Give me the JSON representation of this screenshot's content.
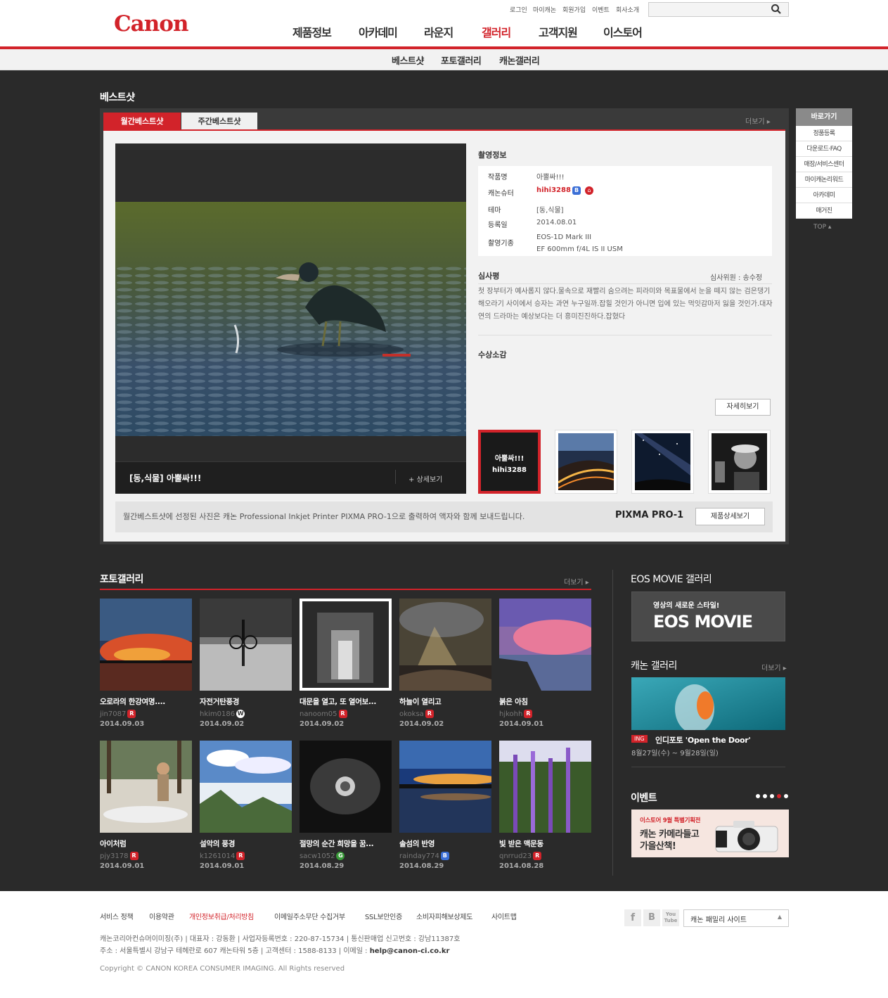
{
  "header": {
    "logo_text": "Canon",
    "util_links": [
      "로그인",
      "마이캐논",
      "회원가입",
      "이벤트",
      "회사소개"
    ],
    "search_placeholder": "",
    "gnb": [
      "제품정보",
      "아카데미",
      "라운지",
      "갤러리",
      "고객지원",
      "이스토어"
    ],
    "subnav": [
      "베스트샷",
      "포토갤러리",
      "캐논갤러리"
    ]
  },
  "best": {
    "section_title": "베스트샷",
    "tabs": [
      "월간베스트샷",
      "주간베스트샷"
    ],
    "more": "더보기",
    "caption": "[동,식물] 아뿔싸!!!",
    "detail_link": "상세보기",
    "info_title": "촬영정보",
    "info": {
      "work_label": "작품명",
      "work_value": "아뿔싸!!!",
      "shooter_label": "캐논슈터",
      "shooter_value": "hihi3288",
      "theme_label": "테마",
      "theme_value": "[동,식물]",
      "date_label": "등록일",
      "date_value": "2014.08.01",
      "camera_label": "촬영기종",
      "camera_value1": "EOS-1D Mark III",
      "camera_value2": "EF 600mm f/4L IS II USM"
    },
    "review_title": "심사평",
    "judge": "심사위원 : 송수정",
    "review_text": "첫 장부터가 예사롭지 않다.물속으로 재빨리 숨으려는 피라미와 목표물에서 눈을 떼지 않는 검은댕기해오라기 사이에서 승자는 과연 누구일까.잡힐 것인가 아니면 입에 있는 먹잇감마저 잃을 것인가.대자연의 드라마는 예상보다는 더 흥미진진하다.잡혔다",
    "award_title": "수상소감",
    "detail_button": "자세히보기",
    "active_thumb_title": "아뿔싸!!!",
    "active_thumb_user": "hihi3288",
    "notice": "월간베스트샷에 선정된 사진은 캐논 Professional Inkjet Printer PIXMA PRO-1으로 출력하여 액자와 함께 보내드립니다.",
    "product_name": "PIXMA PRO-1",
    "product_button": "제품상세보기"
  },
  "quick": {
    "title": "바로가기",
    "items": [
      "정품등록",
      "다운로드·FAQ",
      "매장/서비스센터",
      "마이캐논리워드",
      "아카데미",
      "매거진"
    ],
    "top": "TOP"
  },
  "gallery": {
    "title": "포토갤러리",
    "more": "더보기",
    "items": [
      {
        "title": "오로라의 한강여명....",
        "user": "jin7087",
        "badge": "R",
        "date": "2014.09.03"
      },
      {
        "title": "자전거탄풍경",
        "user": "hkim0186",
        "badge": "W",
        "date": "2014.09.02"
      },
      {
        "title": "대문을 열고, 또 열어보...",
        "user": "nanoom05",
        "badge": "R",
        "date": "2014.09.02"
      },
      {
        "title": "하늘이 열리고",
        "user": "okoksa",
        "badge": "R",
        "date": "2014.09.02"
      },
      {
        "title": "붉은 아침",
        "user": "hjkohh",
        "badge": "R",
        "date": "2014.09.01"
      },
      {
        "title": "아이처럼",
        "user": "pjy3178",
        "badge": "R",
        "date": "2014.09.01"
      },
      {
        "title": "설악의 풍경",
        "user": "k1261014",
        "badge": "R",
        "date": "2014.09.01"
      },
      {
        "title": "절망의 순간 희망을 꿈...",
        "user": "sacw1052",
        "badge": "G",
        "date": "2014.08.29"
      },
      {
        "title": "솔섬의 반영",
        "user": "rainday774",
        "badge": "B",
        "date": "2014.08.29"
      },
      {
        "title": "빛 받은 맥문동",
        "user": "qnrrud23",
        "badge": "R",
        "date": "2014.08.28"
      }
    ]
  },
  "side": {
    "eos_title": "EOS MOVIE 갤러리",
    "eos_banner_sub": "영상의 새로운 스타일!",
    "eos_banner_logo": "EOS MOVIE",
    "canon_gallery_title": "캐논 갤러리",
    "canon_gallery_more": "더보기",
    "ing": "ING",
    "exhibit_title": "인디포토 'Open the Door'",
    "exhibit_date": "8월27일(수) ~ 9월28일(일)",
    "event_title": "이벤트",
    "event_tag": "이스토어 9월 특별기획전",
    "event_line1": "캐논 카메라들고",
    "event_line2": "가을산책!"
  },
  "footer": {
    "links": [
      "서비스 정책",
      "이용약관",
      "개인정보취급/처리방침",
      "이메일주소무단 수집거부",
      "SSL보안인증",
      "소비자피해보상제도",
      "사이트맵"
    ],
    "company_line": "캐논코리아컨슈머이미징(주)  |  대표자 : 강동환  |  사업자등록번호 : 220-87-15734  |  통신판매업 신고번호 : 강남11387호",
    "address_line": "주소 : 서울특별시 강남구 테헤란로 607 캐논타워 5층  |  고객센터 : 1588-8133  |  이메일 : ",
    "email": "help@canon-ci.co.kr",
    "copyright": "Copyright © CANON KOREA CONSUMER IMAGING. All Rights reserved",
    "family_site": "캐논 패밀리 사이트",
    "social": [
      "f",
      "B",
      "You Tube"
    ]
  },
  "colors": {
    "accent": "#d2232a",
    "dark": "#2a2a2a",
    "badge_R": "#d2232a",
    "badge_W": "#ffffff",
    "badge_G": "#3a9b3a",
    "badge_B": "#3b6fd6"
  }
}
